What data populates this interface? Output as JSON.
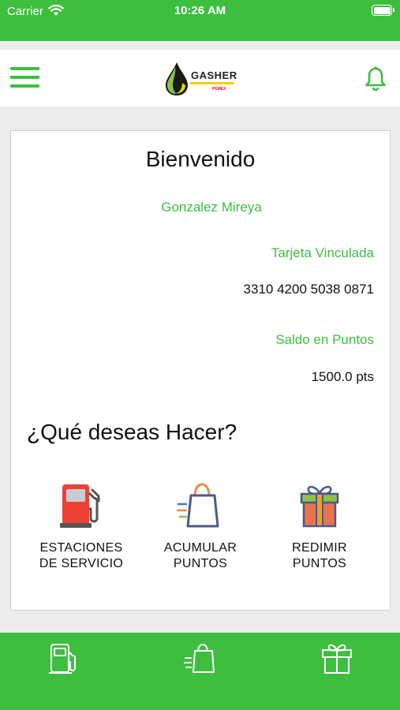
{
  "status_bar": {
    "carrier": "Carrier",
    "time": "10:26 AM"
  },
  "header": {
    "logo_text": "GASHER",
    "logo_sub": "PEMEX"
  },
  "welcome": {
    "title": "Bienvenido",
    "user_name": "Gonzalez Mireya",
    "card_label": "Tarjeta Vinculada",
    "card_number": "3310 4200 5038 0871",
    "points_label": "Saldo en Puntos",
    "points_value": "1500.0 pts"
  },
  "actions": {
    "question": "¿Qué deseas Hacer?",
    "items": [
      {
        "line1": "ESTACIONES",
        "line2": "DE SERVICIO",
        "icon": "gas-pump-icon"
      },
      {
        "line1": "ACUMULAR",
        "line2": "PUNTOS",
        "icon": "shopping-bag-icon"
      },
      {
        "line1": "REDIMIR",
        "line2": "PUNTOS",
        "icon": "gift-icon"
      }
    ]
  },
  "colors": {
    "brand_green": "#3dbe3f",
    "pump_red": "#ee4035",
    "bag_orange": "#f08a4b",
    "gift_box": "#e9734f",
    "gift_lid": "#8bc34a"
  }
}
